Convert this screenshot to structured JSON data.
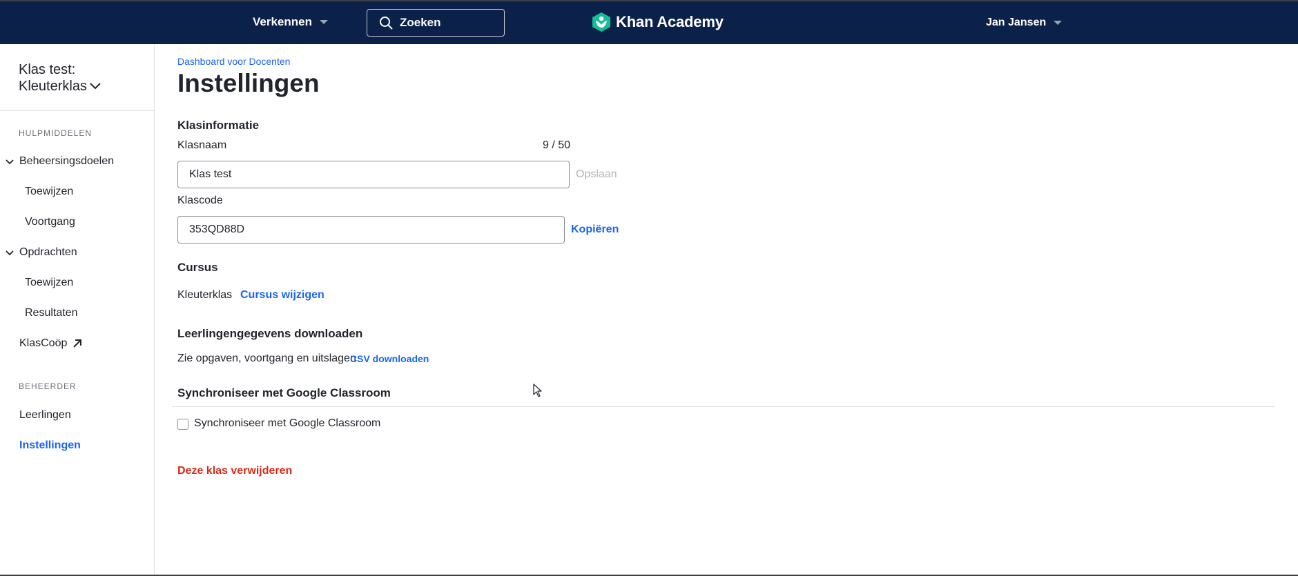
{
  "header": {
    "explore_label": "Verkennen",
    "search_label": "Zoeken",
    "logo_text": "Khan Academy",
    "user_name": "Jan Jansen",
    "icons": {
      "search": "search-icon",
      "logo": "khan-academy-logo-icon",
      "caret": "caret-down-icon"
    },
    "colors": {
      "background": "#0b2149",
      "logo_green": "#14bf96"
    }
  },
  "sidebar": {
    "class_title_line1": "Klas test:",
    "class_title_line2": "Kleuterklas",
    "section_tools": "HULPMIDDELEN",
    "mastery": "Beheersingsdoelen",
    "mastery_assign": "Toewijzen",
    "mastery_progress": "Voortgang",
    "assignments": "Opdrachten",
    "assignments_assign": "Toewijzen",
    "assignments_results": "Resultaten",
    "klascoop": "KlasCoöp",
    "section_admin": "BEHEERDER",
    "students": "Leerlingen",
    "settings": "Instellingen",
    "colors": {
      "active": "#1865f2"
    }
  },
  "main": {
    "breadcrumb": "Dashboard voor Docenten",
    "title": "Instellingen",
    "class_info": {
      "heading": "Klasinformatie",
      "name_label": "Klasnaam",
      "name_counter": "9 / 50",
      "name_value": "Klas test",
      "save_label": "Opslaan",
      "code_label": "Klascode",
      "code_value": "353QD88D",
      "copy_label": "Kopiëren"
    },
    "course": {
      "heading": "Cursus",
      "value": "Kleuterklas",
      "change_label": "Cursus wijzigen"
    },
    "download": {
      "heading": "Leerlingengegevens downloaden",
      "description": "Zie opgaven, voortgang en uitslagen",
      "csv_label": "CSV downloaden"
    },
    "google_sync": {
      "heading": "Synchroniseer met Google Classroom",
      "checkbox_label": "Synchroniseer met Google Classroom",
      "checked": false
    },
    "delete_label": "Deze klas verwijderen",
    "colors": {
      "link": "#1865f2",
      "danger": "#d92916"
    }
  }
}
